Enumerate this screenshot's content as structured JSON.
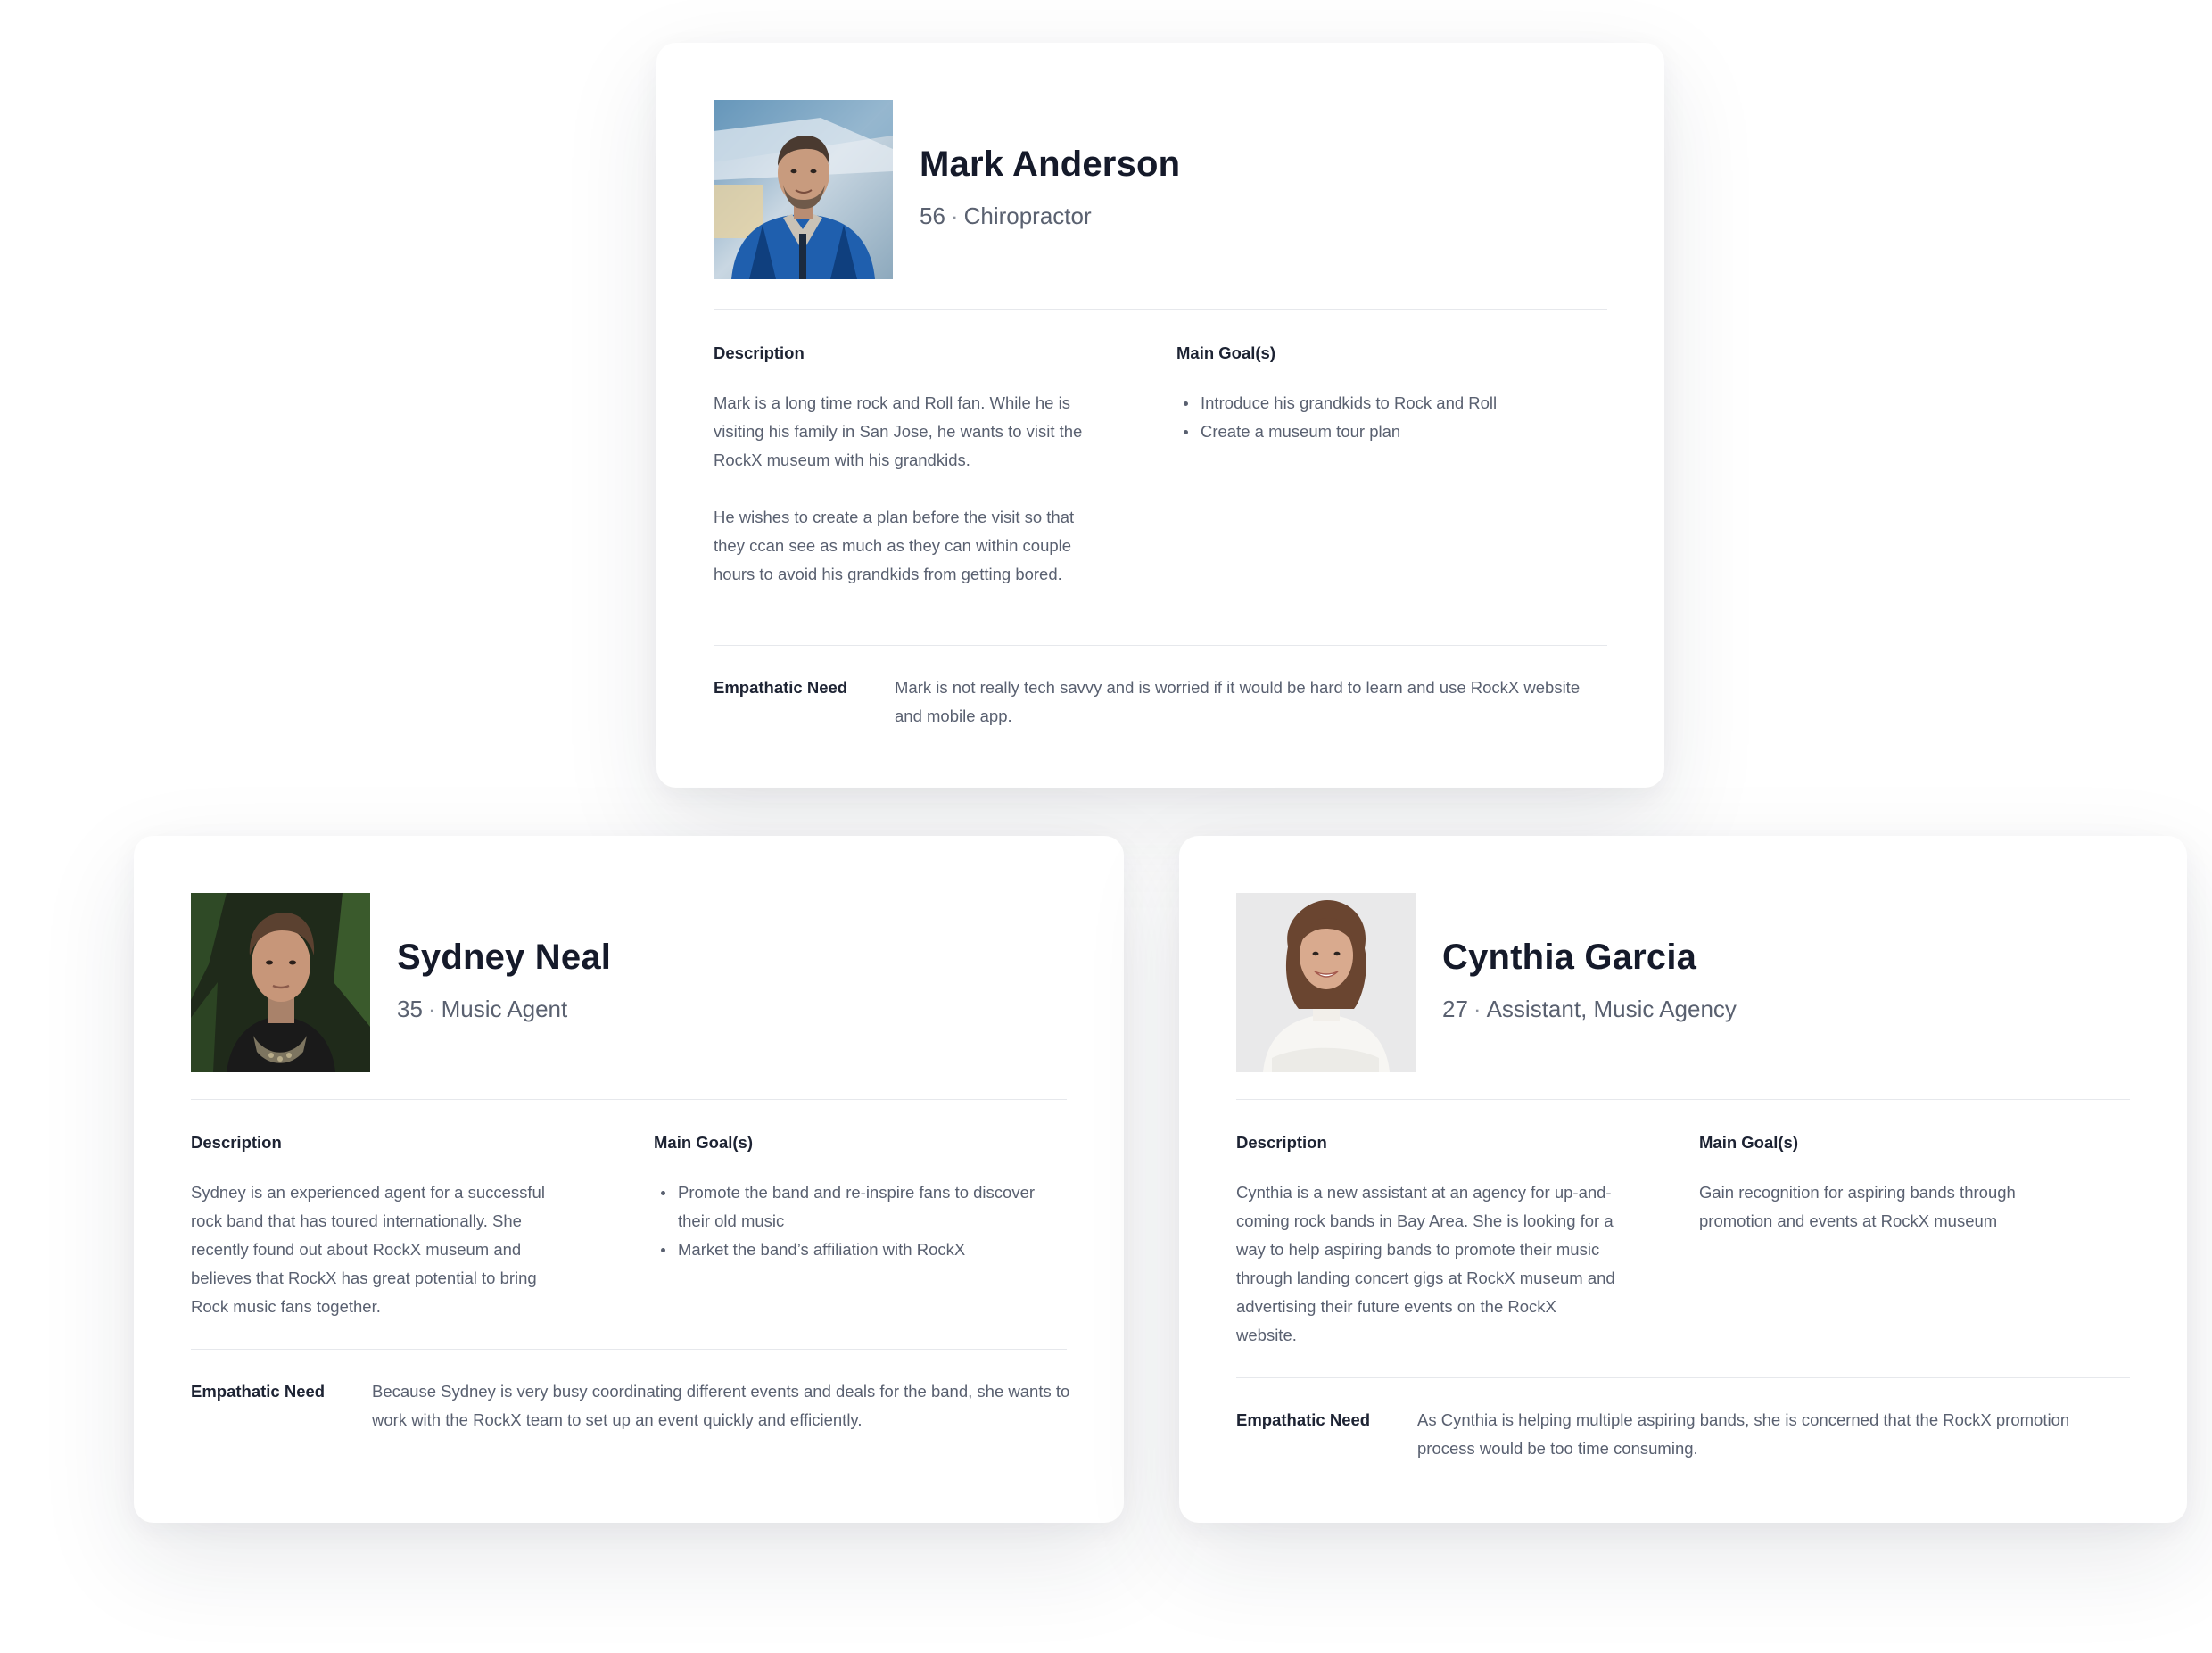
{
  "personas": [
    {
      "name": "Mark Anderson",
      "age": "56",
      "separator": "·",
      "occupation": "Chiropractor",
      "description_label": "Description",
      "description": [
        "Mark is a long time rock and Roll fan. While he is visiting his family in San Jose, he wants to visit the RockX museum with his grandkids.",
        "He wishes to create a plan before the visit so that they ccan see as much as they can within couple hours to avoid his grandkids from getting bored."
      ],
      "goals_label": "Main Goal(s)",
      "goals": [
        "Introduce his grandkids to Rock and Roll",
        "Create a museum tour plan"
      ],
      "need_label": "Empathatic Need",
      "need": "Mark is not really tech savvy and is worried if it would be hard to learn and use RockX website and mobile app."
    },
    {
      "name": "Sydney Neal",
      "age": "35",
      "separator": "·",
      "occupation": "Music Agent",
      "description_label": "Description",
      "description": [
        "Sydney is an experienced agent for a successful rock band that has toured internationally. She recently found out about RockX museum and believes that RockX has great potential to bring Rock music fans together."
      ],
      "goals_label": "Main Goal(s)",
      "goals": [
        "Promote the band and re-inspire fans to discover their old music",
        "Market the band’s affiliation with RockX"
      ],
      "need_label": "Empathatic Need",
      "need": "Because Sydney is very busy coordinating different events and deals for the band, she wants to work with the RockX team to set up an event quickly and efficiently."
    },
    {
      "name": "Cynthia Garcia",
      "age": "27",
      "separator": "·",
      "occupation": "Assistant, Music Agency",
      "description_label": "Description",
      "description": [
        "Cynthia is a new assistant at an agency for up-and-coming rock bands in Bay Area. She is looking for a way to help aspiring bands to promote their music through landing concert gigs at RockX museum and advertising their future events on the RockX website."
      ],
      "goals_label": "Main Goal(s)",
      "goals_text": "Gain recognition for aspiring bands through promotion and events at RockX museum",
      "need_label": "Empathatic Need",
      "need": "As Cynthia is helping multiple aspiring bands, she is concerned that the RockX promotion process would be too time consuming."
    }
  ]
}
